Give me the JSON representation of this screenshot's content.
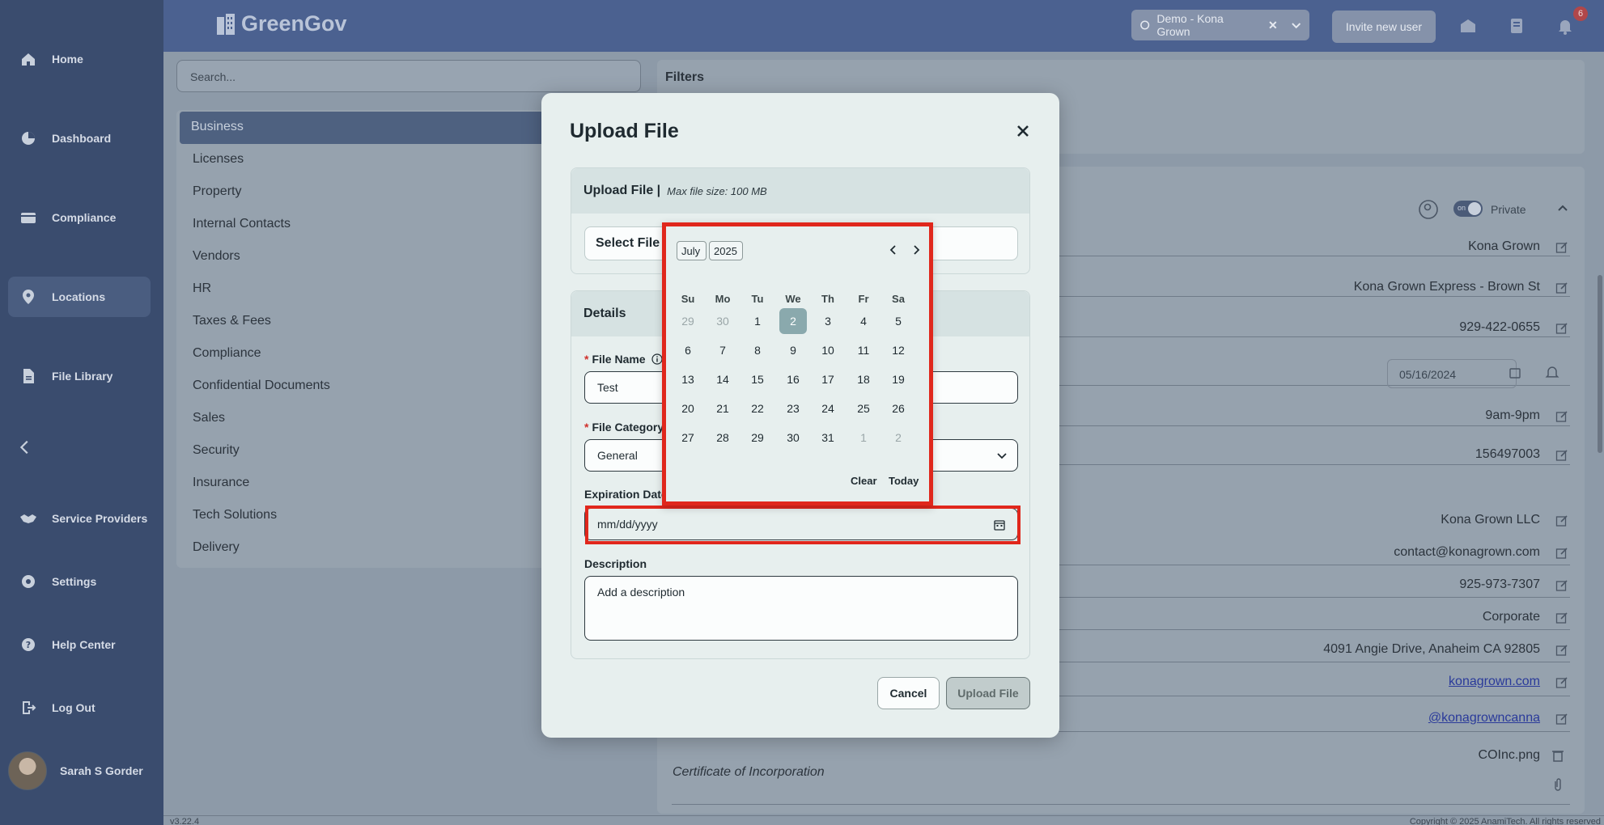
{
  "nav": {
    "items": [
      {
        "label": "Home",
        "icon": "home-icon"
      },
      {
        "label": "Dashboard",
        "icon": "pie-chart-icon"
      },
      {
        "label": "Compliance",
        "icon": "id-card-icon"
      },
      {
        "label": "Locations",
        "icon": "map-pin-icon"
      },
      {
        "label": "File Library",
        "icon": "file-icon"
      },
      {
        "label": "Service Providers",
        "icon": "handshake-icon"
      },
      {
        "label": "Settings",
        "icon": "gear-icon"
      },
      {
        "label": "Help Center",
        "icon": "help-icon"
      },
      {
        "label": "Log Out",
        "icon": "logout-icon"
      }
    ],
    "user_name": "Sarah S Gorder"
  },
  "header": {
    "logo_text": "GreenGov",
    "org_name": "Demo - Kona Grown",
    "invite_label": "Invite new user",
    "notification_count": "6"
  },
  "search": {
    "placeholder": "Search..."
  },
  "categories": [
    "Business",
    "Licenses",
    "Property",
    "Internal Contacts",
    "Vendors",
    "HR",
    "Taxes & Fees",
    "Compliance",
    "Confidential Documents",
    "Sales",
    "Security",
    "Insurance",
    "Tech Solutions",
    "Delivery"
  ],
  "filters": {
    "title": "Filters"
  },
  "details": {
    "private_label": "Private",
    "toggle_text": "on",
    "fields": [
      "Kona Grown",
      "Kona Grown Express - Brown St",
      "929-422-0655",
      "9am-9pm",
      "156497003",
      "Kona Grown LLC",
      "contact@konagrown.com",
      "925-973-7307",
      "Corporate",
      "4091 Angie Drive, Anaheim CA 92805",
      "konagrown.com",
      "@konagrowncanna",
      "COInc.png"
    ],
    "date_value": "05/16/2024",
    "cert_label": "Certificate of Incorporation"
  },
  "footer": {
    "version": "v3.22.4",
    "copyright": "Copyright © 2025 AnamiTech. All rights reserved"
  },
  "modal": {
    "title": "Upload File",
    "upload_section": {
      "title": "Upload File |",
      "max_size": "Max file size: 100 MB",
      "select_label": "Select File"
    },
    "details_section": {
      "title": "Details",
      "file_name_label": "File Name",
      "file_name_value": "Test",
      "category_label": "File Category",
      "category_value": "General",
      "expiration_label": "Expiration Date",
      "expiration_placeholder": "mm/dd/yyyy",
      "description_label": "Description",
      "description_placeholder": "Add a description"
    },
    "cancel_label": "Cancel",
    "upload_label": "Upload File"
  },
  "datepicker": {
    "month": "July",
    "year": "2025",
    "weekdays": [
      "Su",
      "Mo",
      "Tu",
      "We",
      "Th",
      "Fr",
      "Sa"
    ],
    "weeks": [
      [
        "29",
        "30",
        "1",
        "2",
        "3",
        "4",
        "5"
      ],
      [
        "6",
        "7",
        "8",
        "9",
        "10",
        "11",
        "12"
      ],
      [
        "13",
        "14",
        "15",
        "16",
        "17",
        "18",
        "19"
      ],
      [
        "20",
        "21",
        "22",
        "23",
        "24",
        "25",
        "26"
      ],
      [
        "27",
        "28",
        "29",
        "30",
        "31",
        "1",
        "2"
      ]
    ],
    "muted": [
      [
        0,
        0
      ],
      [
        0,
        1
      ],
      [
        4,
        5
      ],
      [
        4,
        6
      ]
    ],
    "today": [
      0,
      3
    ],
    "clear_label": "Clear",
    "today_label": "Today"
  }
}
